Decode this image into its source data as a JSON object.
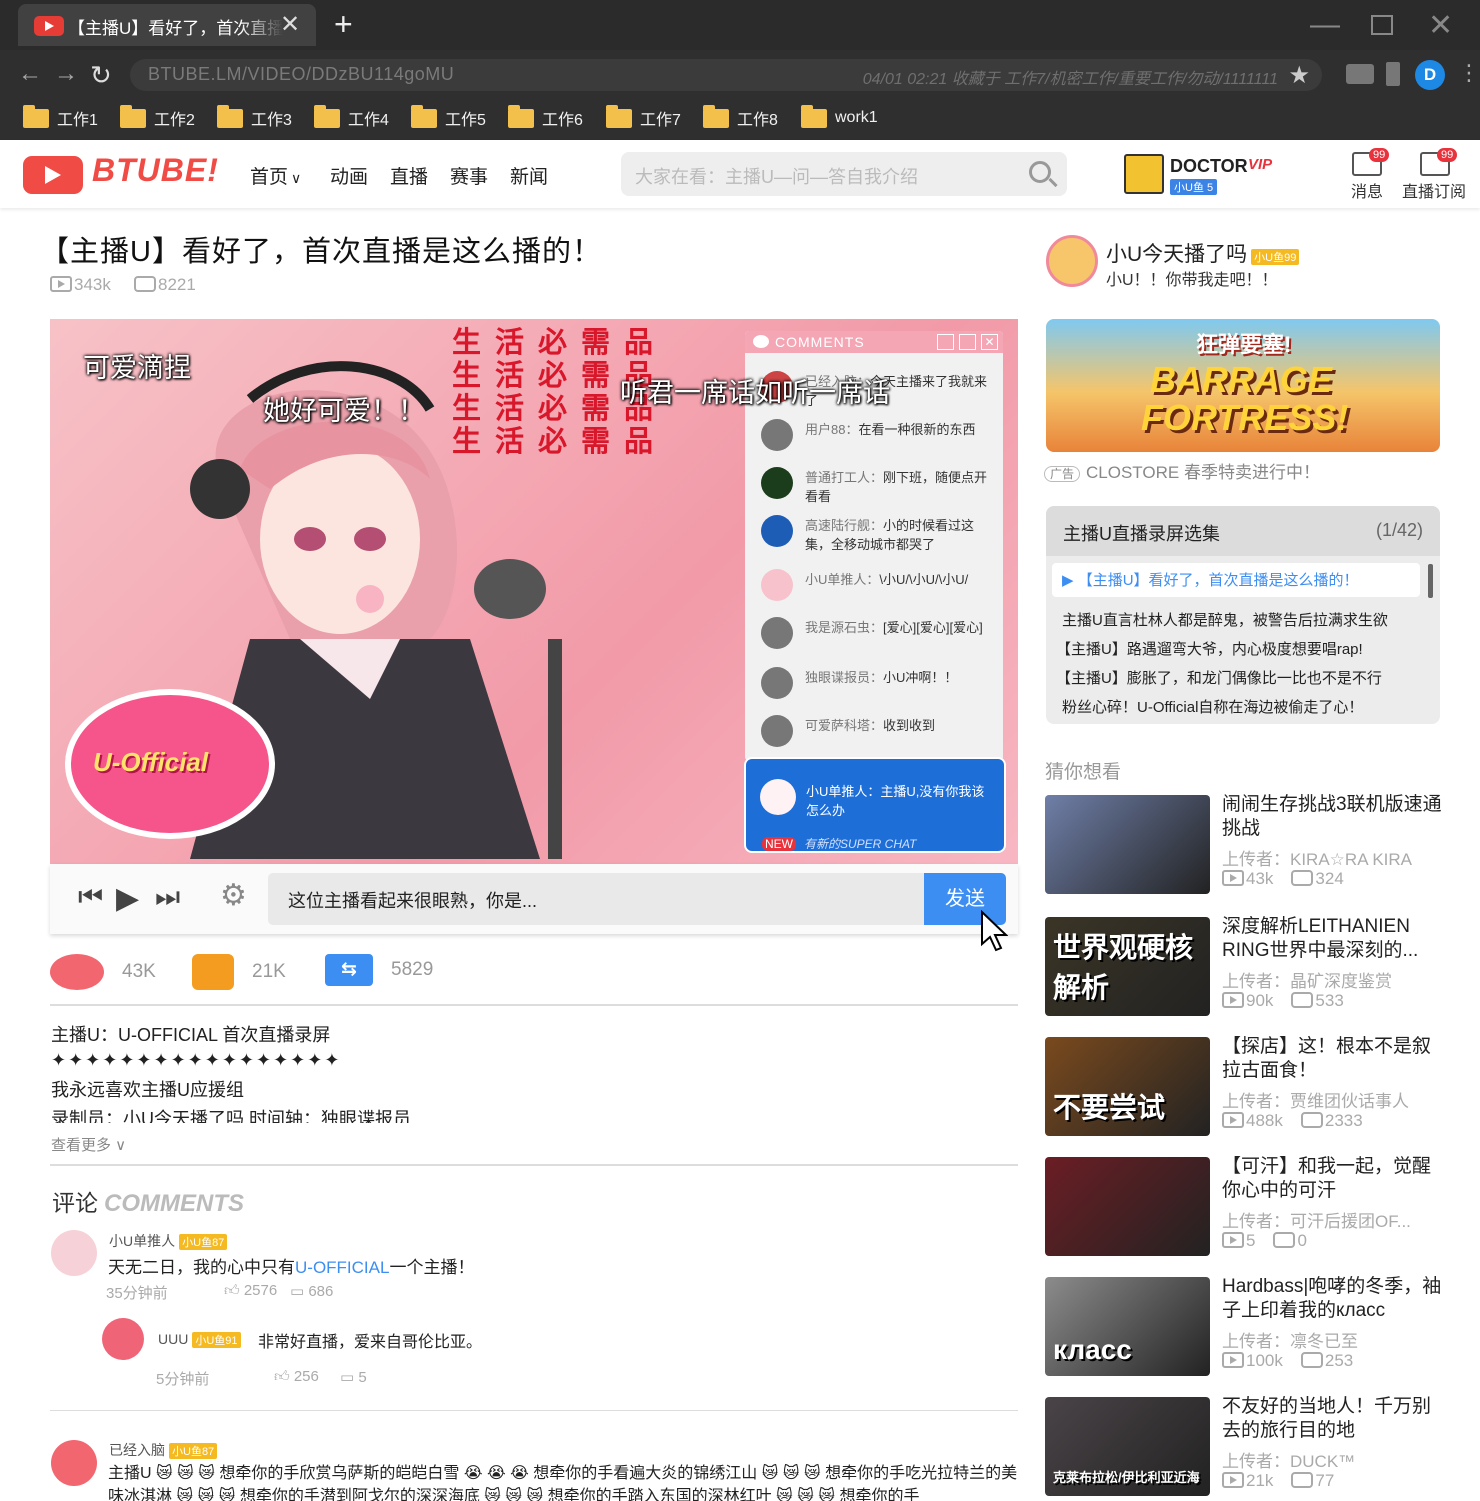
{
  "browser": {
    "tab_title": "【主播U】看好了，首次直播是这么播的！",
    "url": "BTUBE.LM/VIDEO/DDzBU114goMU",
    "url_note": "04/01 02:21 收藏于 工作7/机密工作/重要工作/勿动/1111111",
    "profile_initial": "D",
    "bookmarks": [
      "工作1",
      "工作2",
      "工作3",
      "工作4",
      "工作5",
      "工作6",
      "工作7",
      "工作8",
      "work1"
    ]
  },
  "site": {
    "logo": "BTUBE!",
    "nav": [
      "首页",
      "动画",
      "直播",
      "赛事",
      "新闻"
    ],
    "search_placeholder": "大家在看：主播U—问—答自我介绍",
    "user": {
      "name": "DOCTOR",
      "vip": "VIP",
      "level": "小U鱼 5"
    },
    "messages": {
      "label": "消息",
      "badge": "99"
    },
    "subscriptions": {
      "label": "直播订阅",
      "badge": "99"
    }
  },
  "video": {
    "title": "【主播U】看好了，首次直播是这么播的！",
    "views": "343k",
    "comments": "8221",
    "danmaku": [
      "可爱滴捏",
      "她好可爱！！",
      "听君一席话如听一席话"
    ],
    "poster_text": "生活必需品",
    "logo_text": "U-Official",
    "chat_header": "COMMENTS",
    "chat": [
      {
        "user": "已经入脑：",
        "text": "今天主播来了我就来了"
      },
      {
        "user": "用户88：",
        "text": "在看一种很新的东西"
      },
      {
        "user": "普通打工人：",
        "text": "刚下班，随便点开看看"
      },
      {
        "user": "高速陆行舰：",
        "text": "小的时候看过这集，全移动城市都哭了"
      },
      {
        "user": "小U单推人：",
        "text": "\\小U/\\小U/\\小U/"
      },
      {
        "user": "我是源石虫：",
        "text": "[爱心][爱心][爱心]"
      },
      {
        "user": "独眼谍报员：",
        "text": "小U冲啊！！"
      },
      {
        "user": "可爱萨科塔：",
        "text": "收到收到"
      }
    ],
    "superchat": {
      "user": "小U单推人：",
      "text": "主播U,没有你我该怎么办",
      "badge": "NEW",
      "note": "有新的SUPER CHAT"
    },
    "input_value": "这位主播看起来很眼熟，你是...",
    "send_label": "发送",
    "actions": {
      "favorites": "43K",
      "likes": "21K",
      "coins": "5829"
    },
    "description": [
      "主播U：U-OFFICIAL 首次直播录屏",
      "✦✦✦✦✦✦✦✦✦✦✦✦✦✦✦✦✦",
      "我永远喜欢主播U应援组",
      "录制员：小U今天播了吗 时间轴：独眼谍报员"
    ],
    "see_more": "查看更多"
  },
  "comments": {
    "title": "评论",
    "title_en": "COMMENTS",
    "items": [
      {
        "user": "小U单推人",
        "level": "小U鱼87",
        "text_pre": "天无二日，我的心中只有",
        "text_hl": "U-OFFICIAL",
        "text_post": "一个主播！",
        "time": "35分钟前",
        "likes": "2576",
        "replies": "686"
      },
      {
        "user": "UUU",
        "level": "小U鱼91",
        "text": "非常好直播，爱来自哥伦比亚。",
        "time": "5分钟前",
        "likes": "256",
        "replies": "5"
      },
      {
        "user": "已经入脑",
        "level": "小U鱼87",
        "text": "主播U 😿 😿 😿 想牵你的手欣赏乌萨斯的皑皑白雪 😭 😭 😭 想牵你的手看遍大炎的锦绣江山 😿 😿 😿 想牵你的手吃光拉特兰的美味冰淇淋 😿 😿 😿 想牵你的手潜到阿戈尔的深深海底 😿 😿 😿 想牵你的手踏入东国的深林红叶 😿 😿 😿 想牵你的手"
      }
    ]
  },
  "sidebar": {
    "uploader": {
      "name": "小U今天播了吗",
      "level": "小U鱼99",
      "motto": "小U！！你带我走吧！！"
    },
    "ad": {
      "tag": "广告",
      "text": "CLOSTORE 春季特卖进行中！",
      "title": "BARRAGE FORTRESS!",
      "cn": "狂弹要塞!"
    },
    "playlist": {
      "title": "主播U直播录屏选集",
      "count": "(1/42)",
      "current": "【主播U】看好了，首次直播是这么播的！",
      "items": [
        "主播U直言杜林人都是醉鬼，被警告后拉满求生欲",
        "【主播U】路遇遛弯大爷，内心极度想要唱rap!",
        "【主播U】膨胀了，和龙门偶像比一比也不是不行",
        "粉丝心碎！U-Official自称在海边被偷走了心！"
      ]
    },
    "recommend_title": "猜你想看",
    "recommend": [
      {
        "title": "闹闹生存挑战3联机版速通挑战",
        "uploader": "上传者：KIRA☆RA KIRA",
        "views": "43k",
        "comments": "324",
        "thumb": "#6f7fa8"
      },
      {
        "title": "深度解析LEITHANIEN RING世界中最深刻的...",
        "uploader": "上传者：晶矿深度鉴赏",
        "views": "90k",
        "comments": "533",
        "thumb": "#3b3526",
        "thumb_text": "世界观硬核解析"
      },
      {
        "title": "【探店】这！根本不是叙拉古面食！",
        "uploader": "上传者：贾维团伙话事人",
        "views": "488k",
        "comments": "2333",
        "thumb": "#7a4a1e",
        "thumb_text": "不要尝试"
      },
      {
        "title": "【可汗】和我一起，觉醒你心中的可汗",
        "uploader": "上传者：可汗后援团OF...",
        "views": "5",
        "comments": "0",
        "thumb": "#6b1e24"
      },
      {
        "title": "Hardbass|咆哮的冬季，袖子上印着我的класс",
        "uploader": "上传者：凛冬已至",
        "views": "100k",
        "comments": "253",
        "thumb": "#8c8c8c",
        "thumb_text": "класс"
      },
      {
        "title": "不友好的当地人！千万别去的旅行目的地",
        "uploader": "上传者：DUCK™",
        "views": "21k",
        "comments": "77",
        "thumb": "#4a4448",
        "thumb_text": "克莱布拉松/伊比利亚近海"
      }
    ]
  }
}
